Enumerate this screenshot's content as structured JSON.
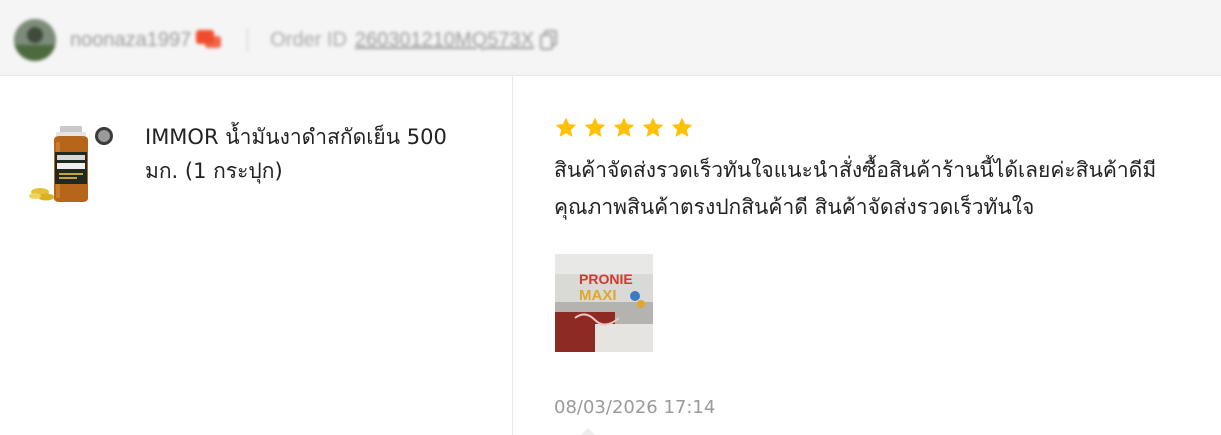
{
  "header": {
    "username": "noonaza1997",
    "order_label": "Order ID",
    "order_id": "260301210MQ573X",
    "avatar_icon": "user-avatar",
    "chat_icon": "chat-bubble-icon",
    "copy_icon": "copy-icon",
    "accent_color": "#ee4d2d"
  },
  "product": {
    "name": "IMMOR น้ำมันงาดำสกัดเย็น 500 มก. (1 กระปุก)",
    "thumbnail": "sesame-oil-bottle"
  },
  "review": {
    "rating": 5,
    "max_rating": 5,
    "star_color": "#ffc107",
    "text_line1": "สินค้าจัดส่งรวดเร็วทันใจแนะนำสั่งซื้อสินค้าร้านนี้ได้เลยค่ะสินค้าดีมี",
    "text_line2": "คุณภาพสินค้าตรงปกสินค้าดี สินค้าจัดส่งรวดเร็วทันใจ",
    "photo_label": "PRONIE MAXI",
    "date": "08/03/2026 17:14"
  }
}
